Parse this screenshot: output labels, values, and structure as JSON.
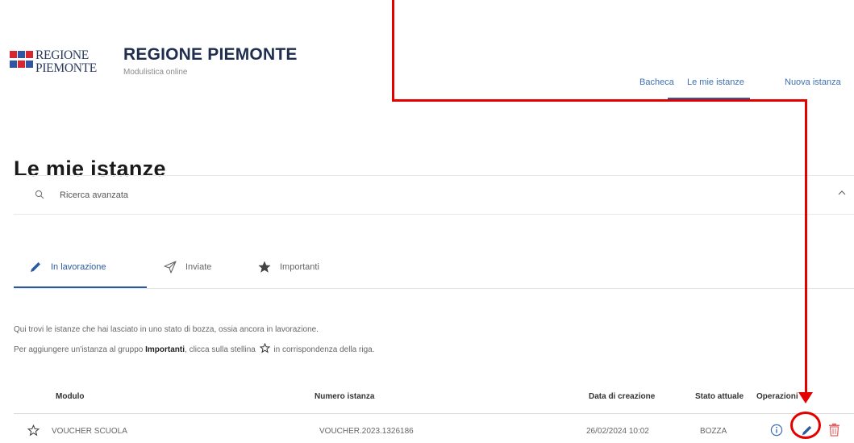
{
  "header": {
    "logo_line1": "REGIONE",
    "logo_line2": "PIEMONTE",
    "title": "REGIONE PIEMONTE",
    "subtitle": "Modulistica online",
    "nav": [
      "Bacheca",
      "Le mie istanze",
      "Nuova istanza"
    ],
    "nav_active": "Le mie istanze"
  },
  "page": {
    "title": "Le mie istanze"
  },
  "search": {
    "label": "Ricerca avanzata"
  },
  "tabs": [
    {
      "label": "In lavorazione",
      "icon": "pencil-icon",
      "active": true
    },
    {
      "label": "Inviate",
      "icon": "paper-plane-icon",
      "active": false
    },
    {
      "label": "Importanti",
      "icon": "star-icon",
      "active": false
    }
  ],
  "description": {
    "line1": "Qui trovi le istanze che hai lasciato in uno stato di bozza, ossia ancora in lavorazione.",
    "line2_pre": "Per aggiungere un'istanza al gruppo ",
    "line2_bold": "Importanti",
    "line2_mid": ", clicca sulla stellina ",
    "line2_post": " in corrispondenza della riga."
  },
  "table": {
    "columns": [
      "Modulo",
      "Numero istanza",
      "Data di creazione",
      "Stato attuale",
      "Operazioni"
    ],
    "rows": [
      {
        "modulo": "VOUCHER SCUOLA",
        "numero": "VOUCHER.2023.1326186",
        "data": "26/02/2024 10:02",
        "stato": "BOZZA"
      }
    ]
  },
  "colors": {
    "accent": "#2c5aa0",
    "logo_red": "#d6262f",
    "logo_blue": "#2f55a4",
    "annotation": "#e50000",
    "delete": "#e06666"
  }
}
